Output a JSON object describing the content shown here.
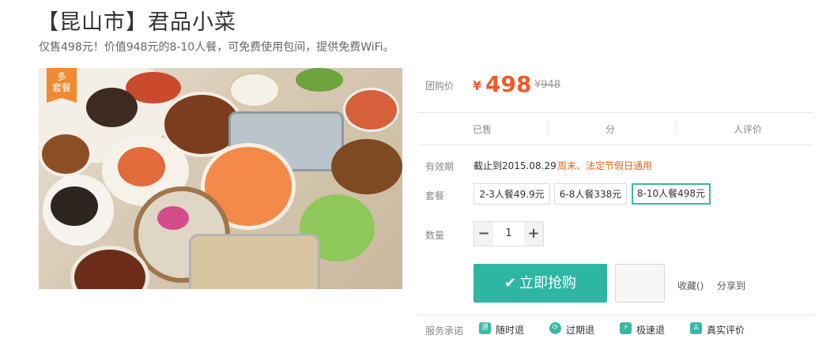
{
  "deal": {
    "title": "【昆山市】君品小菜",
    "subtitle": "仅售498元！价值948元的8-10人餐，可免费使用包间，提供免费WiFi。",
    "badge": "多\n套餐"
  },
  "price": {
    "label": "团购价",
    "currency": "¥",
    "current": "498",
    "original": "¥948"
  },
  "stats": {
    "sold": "已售",
    "rating": "分",
    "reviews": "人评价"
  },
  "validity": {
    "label": "有效期",
    "date": "截止到2015.08.29",
    "note": "周末、法定节假日通用"
  },
  "packages": {
    "label": "套餐",
    "options": [
      "2-3人餐49.9元",
      "6-8人餐338元",
      "8-10人餐498元"
    ],
    "selected": "8-10人餐498元"
  },
  "quantity": {
    "label": "数量",
    "minus": "−",
    "value": "1",
    "plus": "+"
  },
  "actions": {
    "buy": "立即抢购",
    "favorite": "收藏()",
    "share": "分享到"
  },
  "services": {
    "label": "服务承诺",
    "items": [
      {
        "icon": "退",
        "text": "随时退"
      },
      {
        "icon": "⟳",
        "text": "过期退"
      },
      {
        "icon": "⚡",
        "text": "极速退"
      },
      {
        "icon": "♙",
        "text": "真实评价"
      }
    ]
  },
  "colors": {
    "accent": "#2eb5a3",
    "price": "#f05a28",
    "badge": "#f08a32"
  }
}
